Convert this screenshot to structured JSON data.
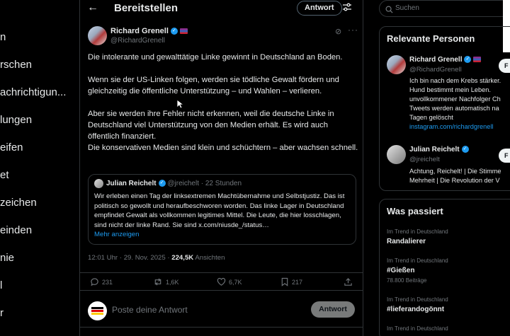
{
  "left_nav": {
    "items": [
      "n",
      "rschen",
      "achrichtigun...",
      "lungen",
      "eifen",
      "et",
      "zeichen",
      "einden",
      "nie",
      "l",
      "r"
    ]
  },
  "header": {
    "back_icon": "arrow-left-icon",
    "title": "Bereitstellen",
    "reply_button": "Antwort",
    "filter_icon": "sliders-icon"
  },
  "tweet": {
    "author_name": "Richard Grenell",
    "author_handle": "@RichardGrenell",
    "body": [
      "Die intolerante und gewalttätige Linke gewinnt in Deutschland an Boden.",
      "Wenn sie der US-Linken folgen, werden sie tödliche Gewalt fördern und gleichzeitig die öffentliche Unterstützung – und Wahlen – verlieren.",
      "Aber sie werden ihre Fehler nicht erkennen, weil die deutsche Linke in Deutschland viel Unterstützung von den Medien erhält. Es wird auch öffentlich finanziert.",
      "Die konservativen Medien sind klein und schüchtern – aber wachsen schnell."
    ],
    "quote": {
      "name": "Julian Reichelt",
      "handle": "@jreichelt",
      "time": "22 Stunden",
      "text": "Wir erleben einen Tag der linksextremen Machtübernahme und Selbstjustiz. Das ist politisch so gewollt und heraufbeschworen worden. Das linke Lager in Deutschland empfindet Gewalt als vollkommen legitimes Mittel. Die Leute, die hier losschlagen, sind nicht der linke Rand. Sie sind x.com/niusde_/status…",
      "show_more": "Mehr anzeigen"
    },
    "time": "12:01 Uhr",
    "date": "29. Nov. 2025",
    "views": "224,5K",
    "views_label": "Ansichten",
    "stats": {
      "replies": "231",
      "reposts": "1,6K",
      "likes": "6,7K",
      "bookmarks": "217"
    }
  },
  "compose": {
    "placeholder": "Poste deine Antwort",
    "button": "Antwort"
  },
  "search": {
    "placeholder": "Suchen"
  },
  "relevant_people": {
    "title": "Relevante Personen",
    "people": [
      {
        "name": "Richard Grenell",
        "handle": "@RichardGrenell",
        "bio": [
          "Ich bin nach dem Krebs stärker.",
          "Hund bestimmt mein Leben.",
          "unvollkommener Nachfolger Ch",
          "Tweets werden automatisch na",
          "Tagen gelöscht"
        ],
        "link": "instagram.com/richardgrenell",
        "follow": "F"
      },
      {
        "name": "Julian Reichelt",
        "handle": "@jreichelt",
        "bio": [
          "Achtung, Reichelt! | Die Stimme",
          "Mehrheit | Die Revolution der V"
        ],
        "follow": "F"
      }
    ]
  },
  "trends": {
    "title": "Was passiert",
    "items": [
      {
        "label": "Im Trend in Deutschland",
        "name": "Randalierer",
        "count": ""
      },
      {
        "label": "Im Trend in Deutschland",
        "name": "#Gießen",
        "count": "78.800 Beiträge"
      },
      {
        "label": "Im Trend in Deutschland",
        "name": "#lieferandogönnt",
        "count": ""
      },
      {
        "label": "Im Trend in Deutschland",
        "name": "",
        "count": ""
      }
    ]
  },
  "colors": {
    "accent": "#1d9bf0",
    "background": "#000000",
    "border": "#2f3336",
    "muted": "#71767b"
  }
}
